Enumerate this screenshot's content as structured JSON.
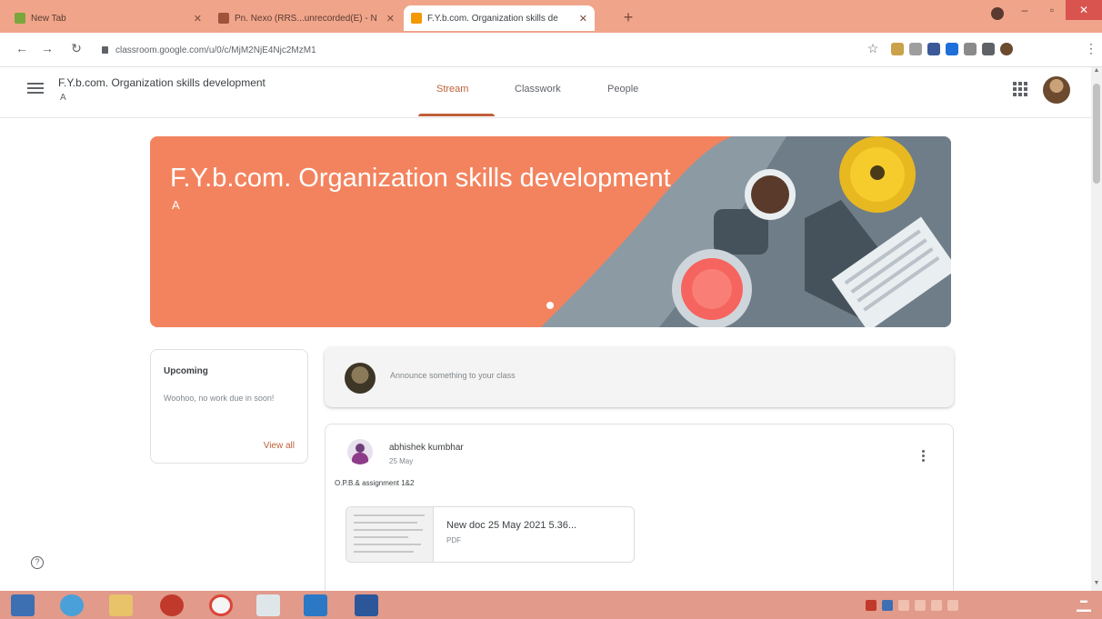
{
  "browser": {
    "tabs": [
      {
        "title": "New Tab",
        "active": false
      },
      {
        "title": "Pn. Nexo (RRS...unrecorded(E) - N",
        "active": false
      },
      {
        "title": "F.Y.b.com. Organization skills de",
        "active": true
      }
    ],
    "new_tab_label": "+",
    "address": "classroom.google.com/u/0/c/MjM2NjE4Njc2MzM1"
  },
  "classroom": {
    "class_name": "F.Y.b.com. Organization skills development",
    "section": "A",
    "nav_tabs": [
      "Stream",
      "Classwork",
      "People"
    ],
    "active_tab": "Stream",
    "theme_color": "#f3835e",
    "accent_color": "#c0603a",
    "banner": {
      "title": "F.Y.b.com. Organization skills development",
      "section": "A"
    },
    "upcoming": {
      "title": "Upcoming",
      "message": "Woohoo, no work due in soon!",
      "link": "View all"
    },
    "announce_placeholder": "Announce something to your class",
    "post": {
      "author": "abhishek kumbhar",
      "date": "25 May",
      "text": "O.P.B.& assignment 1&2",
      "attachment_name": "New doc 25 May 2021 5.36...",
      "attachment_type": "PDF"
    }
  },
  "icons": [
    "hamburger-icon",
    "apps-grid-icon",
    "more-vert-icon",
    "help-icon",
    "back-icon",
    "forward-icon",
    "reload-icon",
    "lock-icon",
    "star-icon"
  ]
}
